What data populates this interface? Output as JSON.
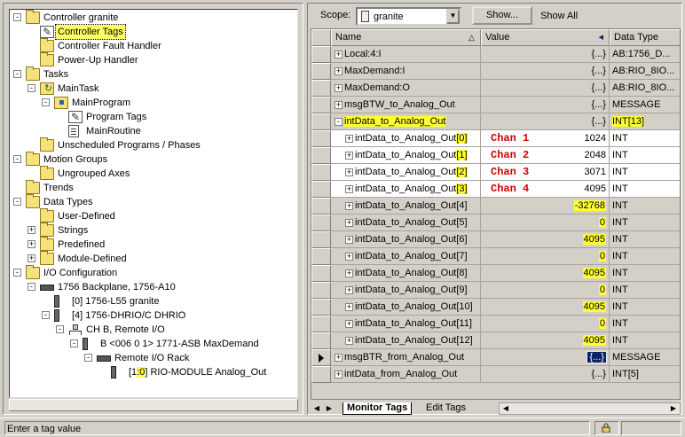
{
  "tree": {
    "items": [
      {
        "label": "Controller granite",
        "level": 0,
        "expander": "-",
        "icon": "folder-icon"
      },
      {
        "label": "Controller Tags",
        "level": 1,
        "expander": "",
        "icon": "tags-icon",
        "selected": true
      },
      {
        "label": "Controller Fault Handler",
        "level": 1,
        "expander": "",
        "icon": "folder-icon"
      },
      {
        "label": "Power-Up Handler",
        "level": 1,
        "expander": "",
        "icon": "folder-icon"
      },
      {
        "label": "Tasks",
        "level": 0,
        "expander": "-",
        "icon": "folder-icon"
      },
      {
        "label": "MainTask",
        "level": 1,
        "expander": "-",
        "icon": "task-icon"
      },
      {
        "label": "MainProgram",
        "level": 2,
        "expander": "-",
        "icon": "program-icon"
      },
      {
        "label": "Program Tags",
        "level": 3,
        "expander": "",
        "icon": "tags-icon"
      },
      {
        "label": "MainRoutine",
        "level": 3,
        "expander": "",
        "icon": "routine-icon"
      },
      {
        "label": "Unscheduled Programs / Phases",
        "level": 1,
        "expander": "",
        "icon": "folder-icon"
      },
      {
        "label": "Motion Groups",
        "level": 0,
        "expander": "-",
        "icon": "folder-icon"
      },
      {
        "label": "Ungrouped Axes",
        "level": 1,
        "expander": "",
        "icon": "folder-icon"
      },
      {
        "label": "Trends",
        "level": 0,
        "expander": "",
        "icon": "folder-icon"
      },
      {
        "label": "Data Types",
        "level": 0,
        "expander": "-",
        "icon": "folder-icon"
      },
      {
        "label": "User-Defined",
        "level": 1,
        "expander": "",
        "icon": "folder-icon"
      },
      {
        "label": "Strings",
        "level": 1,
        "expander": "+",
        "icon": "folder-icon"
      },
      {
        "label": "Predefined",
        "level": 1,
        "expander": "+",
        "icon": "folder-icon"
      },
      {
        "label": "Module-Defined",
        "level": 1,
        "expander": "+",
        "icon": "folder-icon"
      },
      {
        "label": "I/O Configuration",
        "level": 0,
        "expander": "-",
        "icon": "folder-icon"
      },
      {
        "label": "1756 Backplane, 1756-A10",
        "level": 1,
        "expander": "-",
        "icon": "rack-icon"
      },
      {
        "label": "[0] 1756-L55 granite",
        "level": 2,
        "expander": "",
        "icon": "module-icon"
      },
      {
        "label": "[4] 1756-DHRIO/C DHRIO",
        "level": 2,
        "expander": "-",
        "icon": "module-icon"
      },
      {
        "label": "CH B, Remote I/O",
        "level": 3,
        "expander": "-",
        "icon": "network-icon"
      },
      {
        "label": "B <006 0 1> 1771-ASB MaxDemand",
        "level": 4,
        "expander": "-",
        "icon": "module-icon"
      },
      {
        "label": "Remote I/O Rack",
        "level": 5,
        "expander": "-",
        "icon": "rack-icon"
      },
      {
        "label_parts": [
          "[1",
          ":0",
          "] RIO-MODULE Analog_Out"
        ],
        "level": 6,
        "expander": "",
        "icon": "module-icon"
      }
    ]
  },
  "scope": {
    "label": "Scope:",
    "value": "granite"
  },
  "show_button": "Show...",
  "show_all": "Show All",
  "grid": {
    "headers": {
      "name": "Name",
      "value": "Value",
      "type": "Data Type",
      "sort_glyph": "△",
      "value_glyph": "◂"
    },
    "rows": [
      {
        "name": "Local:4:I",
        "value": "{...}",
        "type": "AB:1756_D...",
        "indent": 0,
        "expander": "+"
      },
      {
        "name": "MaxDemand:I",
        "value": "{...}",
        "type": "AB:RIO_8IO...",
        "indent": 0,
        "expander": "+"
      },
      {
        "name": "MaxDemand:O",
        "value": "{...}",
        "type": "AB:RIO_8IO...",
        "indent": 0,
        "expander": "+"
      },
      {
        "name": "msgBTW_to_Analog_Out",
        "value": "{...}",
        "type": "MESSAGE",
        "indent": 0,
        "expander": "+"
      },
      {
        "name": "intData_to_Analog_Out",
        "value": "{...}",
        "type": "INT[13]",
        "indent": 0,
        "expander": "-",
        "name_hl": true,
        "type_hl": true
      },
      {
        "name": "intData_to_Analog_Out",
        "index": "[0]",
        "value": "1024",
        "type": "INT",
        "indent": 1,
        "expander": "+",
        "white": true,
        "chan": "Chan 1",
        "index_hl": true
      },
      {
        "name": "intData_to_Analog_Out",
        "index": "[1]",
        "value": "2048",
        "type": "INT",
        "indent": 1,
        "expander": "+",
        "white": true,
        "chan": "Chan 2",
        "index_hl": true
      },
      {
        "name": "intData_to_Analog_Out",
        "index": "[2]",
        "value": "3071",
        "type": "INT",
        "indent": 1,
        "expander": "+",
        "white": true,
        "chan": "Chan 3",
        "index_hl": true
      },
      {
        "name": "intData_to_Analog_Out",
        "index": "[3]",
        "value": "4095",
        "type": "INT",
        "indent": 1,
        "expander": "+",
        "white": true,
        "chan": "Chan 4",
        "index_hl": true
      },
      {
        "name": "intData_to_Analog_Out",
        "index": "[4]",
        "value": "-32768",
        "type": "INT",
        "indent": 1,
        "expander": "+",
        "value_hl": true
      },
      {
        "name": "intData_to_Analog_Out",
        "index": "[5]",
        "value": "0",
        "type": "INT",
        "indent": 1,
        "expander": "+",
        "value_hl": true
      },
      {
        "name": "intData_to_Analog_Out",
        "index": "[6]",
        "value": "4095",
        "type": "INT",
        "indent": 1,
        "expander": "+",
        "value_hl": true
      },
      {
        "name": "intData_to_Analog_Out",
        "index": "[7]",
        "value": "0",
        "type": "INT",
        "indent": 1,
        "expander": "+",
        "value_hl": true
      },
      {
        "name": "intData_to_Analog_Out",
        "index": "[8]",
        "value": "4095",
        "type": "INT",
        "indent": 1,
        "expander": "+",
        "value_hl": true
      },
      {
        "name": "intData_to_Analog_Out",
        "index": "[9]",
        "value": "0",
        "type": "INT",
        "indent": 1,
        "expander": "+",
        "value_hl": true
      },
      {
        "name": "intData_to_Analog_Out",
        "index": "[10]",
        "value": "4095",
        "type": "INT",
        "indent": 1,
        "expander": "+",
        "value_hl": true
      },
      {
        "name": "intData_to_Analog_Out",
        "index": "[11]",
        "value": "0",
        "type": "INT",
        "indent": 1,
        "expander": "+",
        "value_hl": true
      },
      {
        "name": "intData_to_Analog_Out",
        "index": "[12]",
        "value": "4095",
        "type": "INT",
        "indent": 1,
        "expander": "+",
        "value_hl": true
      },
      {
        "name": "msgBTR_from_Analog_Out",
        "value": "{...}",
        "type": "MESSAGE",
        "indent": 0,
        "expander": "+",
        "current": true,
        "value_sel": true
      },
      {
        "name": "intData_from_Analog_Out",
        "value": "{...}",
        "type": "INT[5]",
        "indent": 0,
        "expander": "+"
      }
    ]
  },
  "tabs": [
    {
      "label": "Monitor Tags",
      "active": true
    },
    {
      "label": "Edit Tags",
      "active": false
    }
  ],
  "status_text": "Enter a tag value",
  "colors": {
    "highlight": "#ffff33",
    "chan_label": "#d00000",
    "selection": "#0a246a"
  }
}
